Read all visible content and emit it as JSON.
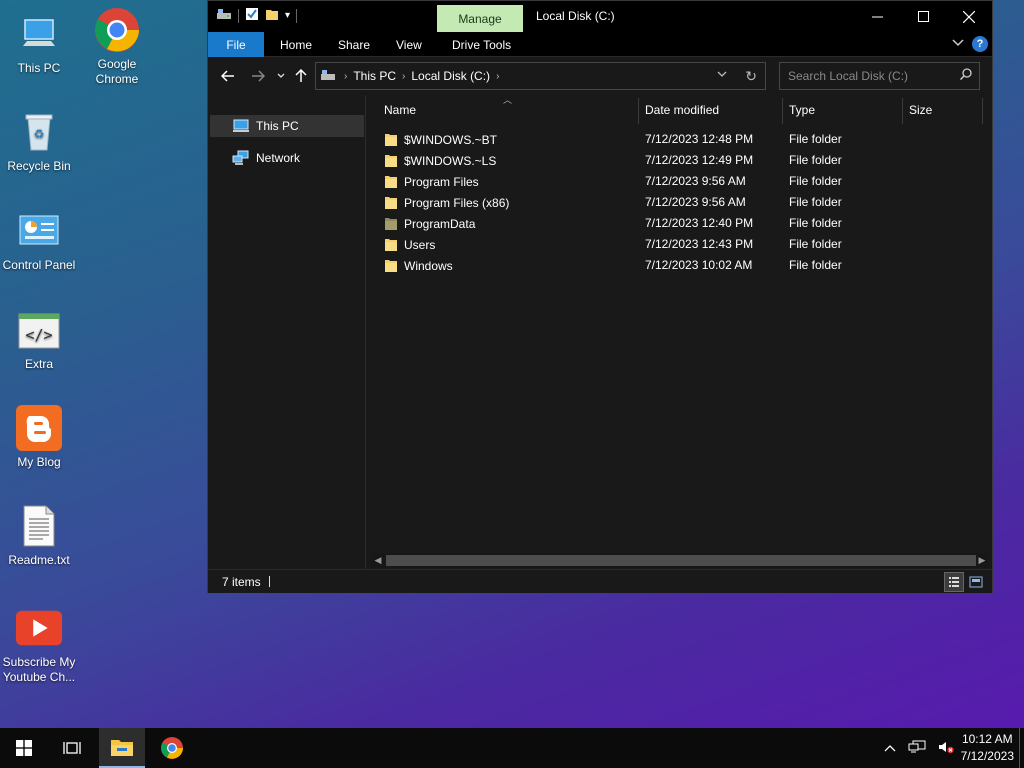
{
  "desktop": {
    "icons": [
      {
        "label": "This PC",
        "icon": "this-pc-icon"
      },
      {
        "label": "Google Chrome",
        "icon": "chrome-icon"
      },
      {
        "label": "Recycle Bin",
        "icon": "recycle-bin-icon"
      },
      {
        "label": "Control Panel",
        "icon": "control-panel-icon"
      },
      {
        "label": "Extra",
        "icon": "code-window-icon"
      },
      {
        "label": "My Blog",
        "icon": "blogger-icon"
      },
      {
        "label": "Readme.txt",
        "icon": "text-file-icon"
      },
      {
        "label": "Subscribe My Youtube Ch...",
        "icon": "youtube-icon"
      }
    ]
  },
  "window": {
    "title": "Local Disk (C:)",
    "contextual_tab": "Manage",
    "ribbon_tabs": [
      "File",
      "Home",
      "Share",
      "View",
      "Drive Tools"
    ],
    "breadcrumb": [
      "This PC",
      "Local Disk (C:)"
    ],
    "search_placeholder": "Search Local Disk (C:)",
    "nav_pane": [
      {
        "label": "This PC",
        "selected": true
      },
      {
        "label": "Network",
        "selected": false
      }
    ],
    "columns": [
      "Name",
      "Date modified",
      "Type",
      "Size"
    ],
    "rows": [
      {
        "name": "$WINDOWS.~BT",
        "date": "7/12/2023 12:48 PM",
        "type": "File folder"
      },
      {
        "name": "$WINDOWS.~LS",
        "date": "7/12/2023 12:49 PM",
        "type": "File folder"
      },
      {
        "name": "Program Files",
        "date": "7/12/2023 9:56 AM",
        "type": "File folder"
      },
      {
        "name": "Program Files (x86)",
        "date": "7/12/2023 9:56 AM",
        "type": "File folder"
      },
      {
        "name": "ProgramData",
        "date": "7/12/2023 12:40 PM",
        "type": "File folder"
      },
      {
        "name": "Users",
        "date": "7/12/2023 12:43 PM",
        "type": "File folder"
      },
      {
        "name": "Windows",
        "date": "7/12/2023 10:02 AM",
        "type": "File folder"
      }
    ],
    "status": "7 items"
  },
  "taskbar": {
    "time": "10:12 AM",
    "date": "7/12/2023"
  },
  "colors": {
    "accent": "#1979ca",
    "manage_tab": "#c4e9b3",
    "folder": "#f4d06f"
  }
}
